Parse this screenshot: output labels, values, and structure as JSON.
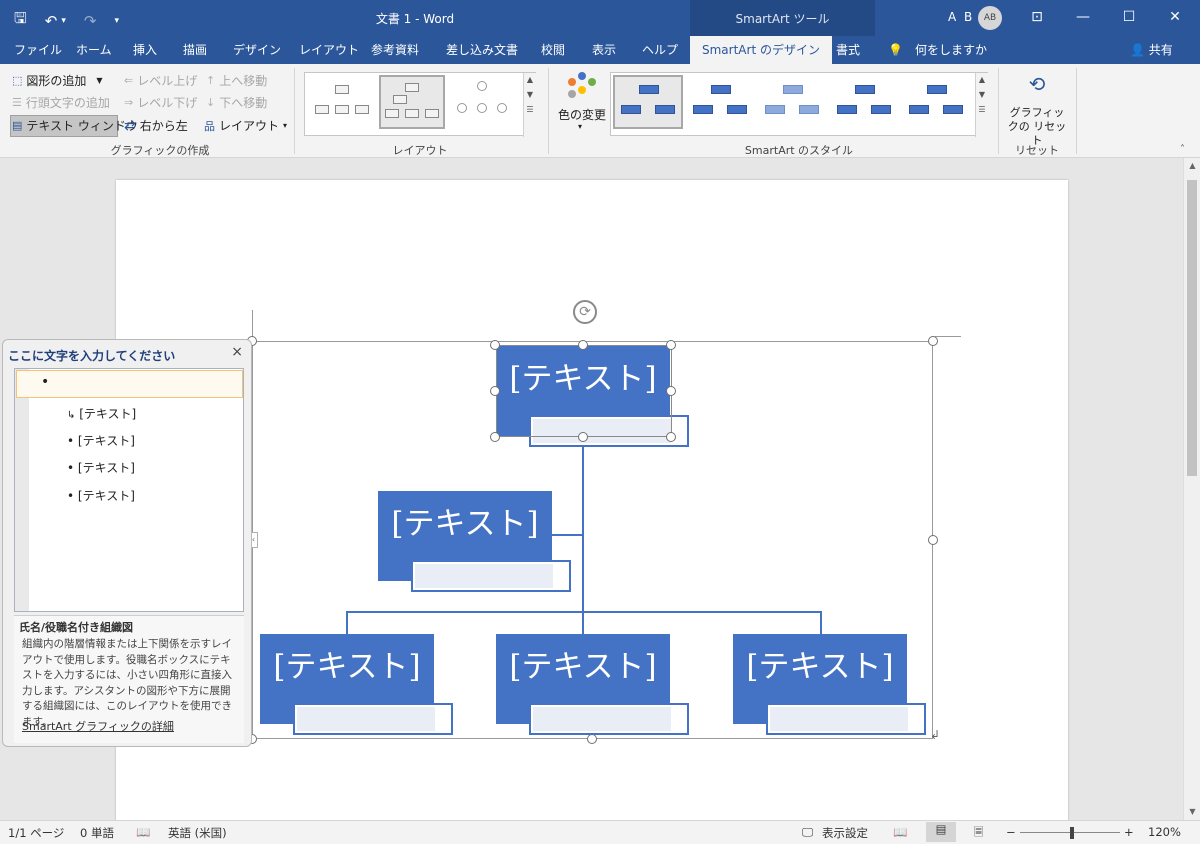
{
  "title_bar": {
    "doc_title": "文書 1  -  Word",
    "tools_title": "SmartArt ツール",
    "user_initials": "A B",
    "avatar": "AB",
    "qat": {
      "save": "🖫",
      "undo": "↶",
      "undo_arrow": "▾",
      "redo": "↷",
      "customize": "▾"
    },
    "window_controls": {
      "ribbon_display": "⊡",
      "minimize": "—",
      "maximize": "☐",
      "close": "✕"
    }
  },
  "tabs": [
    "ファイル",
    "ホーム",
    "挿入",
    "描画",
    "デザイン",
    "レイアウト",
    "参考資料",
    "差し込み文書",
    "校閲",
    "表示",
    "ヘルプ",
    "SmartArt のデザイン",
    "書式"
  ],
  "tell_me": "何をしますか",
  "share": "共有",
  "ribbon": {
    "create": {
      "add_shape": "図形の追加",
      "add_bullet": "行頭文字の追加",
      "text_pane": "テキスト ウィンドウ",
      "promote": "レベル上げ",
      "demote": "レベル下げ",
      "right_to_left": "右から左",
      "move_up": "上へ移動",
      "move_down": "下へ移動",
      "layout": "レイアウト",
      "group_label": "グラフィックの作成"
    },
    "layouts": {
      "group_label": "レイアウト"
    },
    "styles": {
      "change_colors": "色の変更",
      "group_label": "SmartArt のスタイル"
    },
    "reset": {
      "reset_graphic": "グラフィックの リセット",
      "group_label": "リセット"
    }
  },
  "smartart": {
    "nodes": [
      "[テキスト]",
      "[テキスト]",
      "[テキスト]",
      "[テキスト]",
      "[テキスト]"
    ]
  },
  "text_pane": {
    "header": "ここに文字を入力してください",
    "items": [
      "",
      "[テキスト]",
      "[テキスト]",
      "[テキスト]",
      "[テキスト]"
    ],
    "desc_title": "氏名/役職名付き組織図",
    "desc_body": "組織内の階層情報または上下関係を示すレイアウトで使用します。役職名ボックスにテキストを入力するには、小さい四角形に直接入力します。アシスタントの図形や下方に展開する組織図には、このレイアウトを使用できます。",
    "desc_link": "SmartArt グラフィックの詳細"
  },
  "status_bar": {
    "page": "1/1 ページ",
    "words": "0 単語",
    "language": "英語 (米国)",
    "display_settings": "表示設定",
    "zoom_minus": "−",
    "zoom_plus": "+",
    "zoom": "120%",
    "zoom_level": 0.52
  },
  "colors": {
    "accent": "#2b579a",
    "smartart_blue": "#4472c4"
  }
}
